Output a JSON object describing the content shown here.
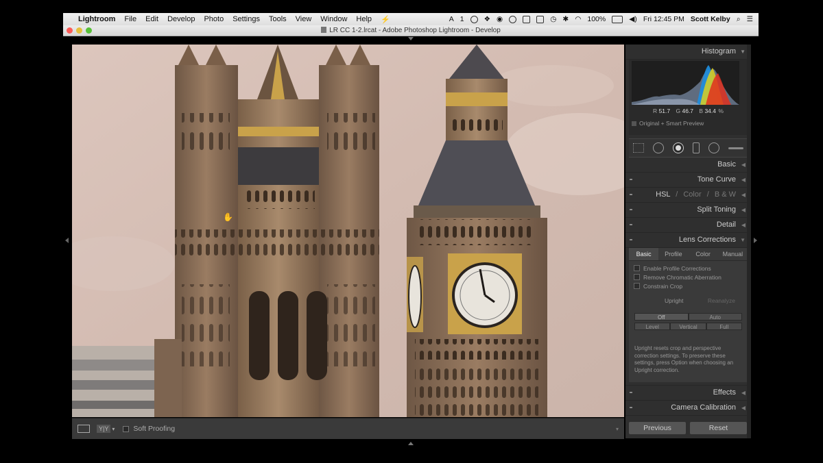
{
  "menubar": {
    "apple": "",
    "app_name": "Lightroom",
    "items": [
      "File",
      "Edit",
      "Develop",
      "Photo",
      "Settings",
      "Tools",
      "View",
      "Window",
      "Help"
    ],
    "badge": "1",
    "battery": "100%",
    "clock": "Fri 12:45 PM",
    "user": "Scott Kelby"
  },
  "window": {
    "title": "LR CC 1-2.lrcat - Adobe Photoshop Lightroom - Develop"
  },
  "toolbar": {
    "yy_label": "Y|Y",
    "soft_proofing": "Soft Proofing"
  },
  "panel": {
    "histogram": {
      "title": "Histogram",
      "r_label": "R",
      "r_value": "51.7",
      "g_label": "G",
      "g_value": "46.7",
      "b_label": "B",
      "b_value": "34.4",
      "unit": "%",
      "preview": "Original + Smart Preview"
    },
    "sections": {
      "basic": "Basic",
      "tone_curve": "Tone Curve",
      "hsl": "HSL",
      "color": "Color",
      "bw": "B & W",
      "sep": "/",
      "split_toning": "Split Toning",
      "detail": "Detail",
      "lens_corrections": "Lens Corrections",
      "effects": "Effects",
      "camera_calibration": "Camera Calibration"
    },
    "lens": {
      "tabs": [
        "Basic",
        "Profile",
        "Color",
        "Manual"
      ],
      "checks": [
        "Enable Profile Corrections",
        "Remove Chromatic Aberration",
        "Constrain Crop"
      ],
      "upright": "Upright",
      "reanalyze": "Reanalyze",
      "modes1": [
        "Off",
        "Auto"
      ],
      "modes2": [
        "Level",
        "Vertical",
        "Full"
      ],
      "note": "Upright resets crop and perspective correction settings. To preserve these settings, press Option when choosing an Upright correction."
    },
    "buttons": {
      "previous": "Previous",
      "reset": "Reset"
    }
  },
  "colors": {
    "panel_bg": "#2f2f2f",
    "sky": "#d4bcb3",
    "stone": "#8a6e55"
  }
}
